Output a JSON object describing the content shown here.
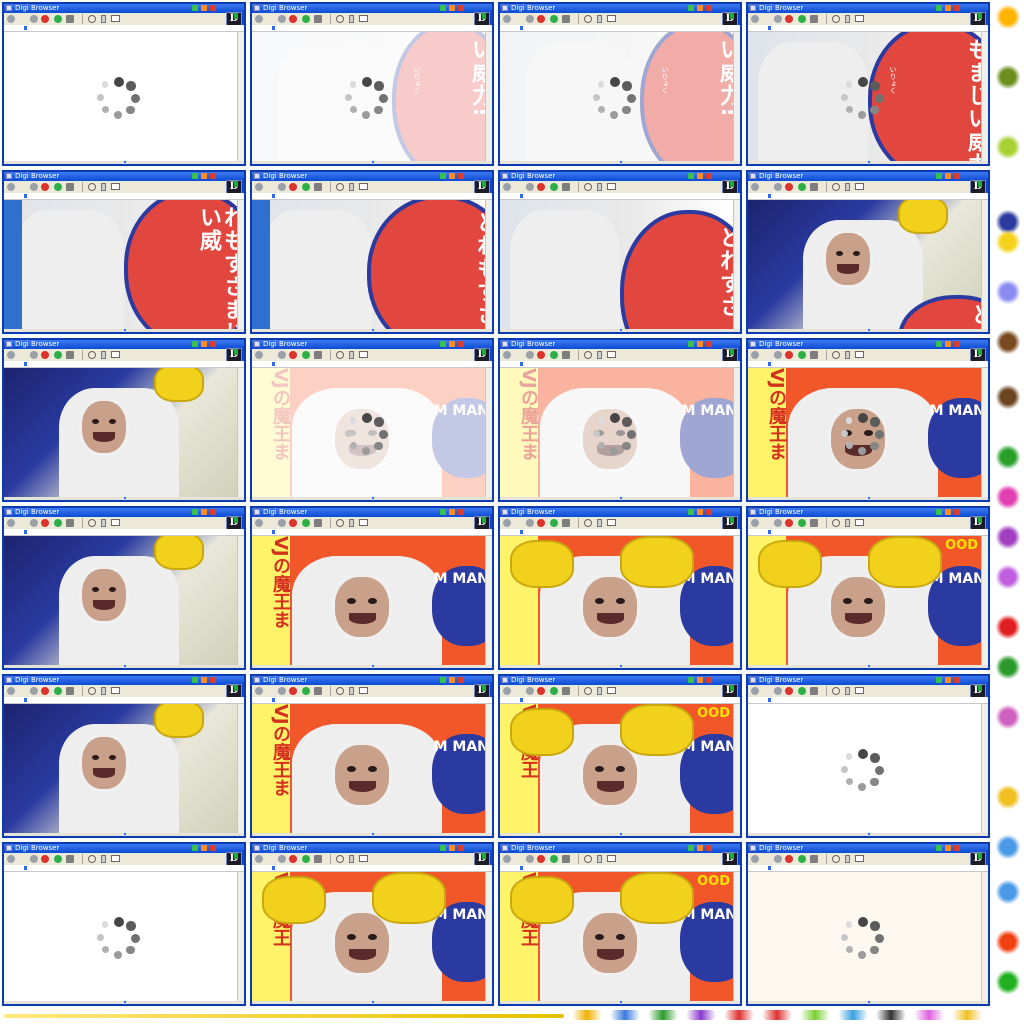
{
  "window": {
    "title": "Digi Browser",
    "logo_letter": "D"
  },
  "frames": [
    {
      "scene": "loading"
    },
    {
      "scene": "sign1",
      "sign_text": "い威力!",
      "small_text": "いりょく",
      "fade": "strong",
      "spinner": true
    },
    {
      "scene": "sign1",
      "sign_text": "い威力!",
      "small_text": "いりょく",
      "fade": "light",
      "spinner": true
    },
    {
      "scene": "sign2",
      "sign_text": "もまじい威力",
      "small_text": "いりょく",
      "fade": "none",
      "spinner": true
    },
    {
      "scene": "sign3",
      "sign_text": "れもすさまじい威",
      "fade": "none"
    },
    {
      "scene": "sign4",
      "sign_text": "どれもすさま",
      "fade": "none"
    },
    {
      "scene": "sign5",
      "sign_text": "どれすさ",
      "fade": "none"
    },
    {
      "scene": "cat1",
      "sign_text": "ど",
      "fade": "none"
    },
    {
      "scene": "cat2",
      "fade": "none"
    },
    {
      "scene": "mang",
      "mag": "M MANG",
      "bubble": "VJの魔王ま",
      "fade": "strong",
      "spinner": true
    },
    {
      "scene": "mang",
      "mag": "M MANG",
      "bubble": "VJの魔王ま",
      "fade": "light",
      "spinner": true
    },
    {
      "scene": "mang",
      "mag": "M MANG",
      "bubble": "VJの魔王ま",
      "fade": "none",
      "spinner": true
    },
    {
      "scene": "cat2",
      "fade": "none"
    },
    {
      "scene": "mang",
      "mag": "M MANG",
      "bubble": "VJの魔王ま",
      "fade": "none"
    },
    {
      "scene": "tiger",
      "mag": "M MANG",
      "bubble": "",
      "fade": "none"
    },
    {
      "scene": "tiger",
      "mag": "M MANG",
      "bubble": "",
      "extra": "OOD",
      "fade": "none"
    },
    {
      "scene": "cat2",
      "fade": "none"
    },
    {
      "scene": "mang",
      "mag": "M MANG",
      "bubble": "VJの魔王ま",
      "fade": "none"
    },
    {
      "scene": "tiger",
      "mag": "M MANG",
      "bubble": "VJの魔王",
      "extra": "OOD",
      "fade": "none"
    },
    {
      "scene": "loading"
    },
    {
      "scene": "loading"
    },
    {
      "scene": "tiger",
      "mag": "M MANG",
      "bubble": "VJの魔王",
      "fade": "none"
    },
    {
      "scene": "tiger",
      "mag": "M MANG",
      "bubble": "VJの魔王",
      "extra": "OOD",
      "fade": "none"
    },
    {
      "scene": "faded",
      "fade": "strong",
      "spinner": true
    }
  ],
  "colors": {
    "window_blue": "#0b46d8",
    "sign_red": "#e2473f",
    "mag_blue": "#2a3aa0",
    "orange_bg": "#f2572a",
    "glove_yellow": "#f2d11c"
  },
  "icons": [
    "back-icon",
    "forward-icon",
    "stop-icon",
    "refresh-icon",
    "home-icon",
    "search-icon",
    "page-icon",
    "mail-icon",
    "minimize-icon",
    "maximize-icon",
    "close-icon"
  ]
}
